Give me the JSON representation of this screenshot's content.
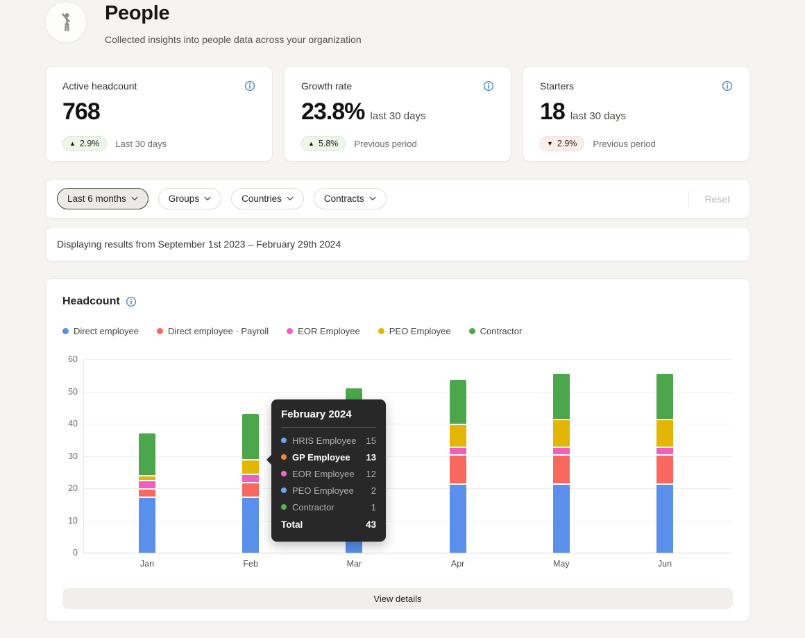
{
  "header": {
    "title": "People",
    "subtitle": "Collected insights into people data across your organization"
  },
  "stats": [
    {
      "label": "Active headcount",
      "value": "768",
      "suffix": "",
      "badge": {
        "dir": "up",
        "arrow": "▲",
        "text": "2.9%"
      },
      "badge_label": "Last 30 days"
    },
    {
      "label": "Growth rate",
      "value": "23.8%",
      "suffix": "last 30 days",
      "badge": {
        "dir": "up",
        "arrow": "▲",
        "text": "5.8%"
      },
      "badge_label": "Previous period"
    },
    {
      "label": "Starters",
      "value": "18",
      "suffix": "last 30 days",
      "badge": {
        "dir": "down",
        "arrow": "▼",
        "text": "2.9%"
      },
      "badge_label": "Previous period"
    }
  ],
  "filters": {
    "pills": [
      {
        "label": "Last 6 months",
        "active": true
      },
      {
        "label": "Groups",
        "active": false
      },
      {
        "label": "Countries",
        "active": false
      },
      {
        "label": "Contracts",
        "active": false
      }
    ],
    "reset_label": "Reset"
  },
  "banner": {
    "text": "Displaying results from September 1st 2023 – February 29th 2024"
  },
  "chart": {
    "title": "Headcount"
  },
  "chart_data": {
    "type": "bar",
    "stacked": true,
    "title": "Headcount",
    "categories": [
      "Jan",
      "Feb",
      "Mar",
      "Apr",
      "May",
      "Jun"
    ],
    "series": [
      {
        "name": "Direct employee",
        "color": "#5b8fec",
        "values": [
          17.5,
          17.5,
          17.5,
          21.5,
          21.5,
          21.5
        ]
      },
      {
        "name": "Direct employee · Payroll",
        "color": "#f9685f",
        "values": [
          2.5,
          4.5,
          4.5,
          9,
          9,
          9
        ]
      },
      {
        "name": "EOR Employee",
        "color": "#ee5fc0",
        "values": [
          2.5,
          2.5,
          3,
          2.5,
          2.5,
          2.5
        ]
      },
      {
        "name": "PEO Employee",
        "color": "#e3b505",
        "values": [
          1.5,
          4.5,
          6,
          7,
          8.5,
          8.5
        ]
      },
      {
        "name": "Contractor",
        "color": "#4ca64c",
        "values": [
          13,
          14,
          20,
          13.5,
          14,
          14
        ]
      }
    ],
    "totals": [
      37,
      43,
      51,
      53.5,
      55.5,
      55.5
    ],
    "ylim": [
      0,
      60
    ],
    "yticks": [
      0,
      10,
      20,
      30,
      40,
      50,
      60
    ],
    "grid": true,
    "legend_position": "top"
  },
  "tooltip": {
    "title": "February 2024",
    "rows": [
      {
        "label": "HRIS Employee",
        "value": "15",
        "color": "#6ca6ea",
        "emphasis": false
      },
      {
        "label": "GP Employee",
        "value": "13",
        "color": "#ef8b3d",
        "emphasis": true
      },
      {
        "label": "EOR Employee",
        "value": "12",
        "color": "#f468c6",
        "emphasis": false
      },
      {
        "label": "PEO Employee",
        "value": "2",
        "color": "#6ca6ea",
        "emphasis": false
      },
      {
        "label": "Contractor",
        "value": "1",
        "color": "#58b158",
        "emphasis": false
      }
    ],
    "total_label": "Total",
    "total_value": "43"
  },
  "view_details_label": "View details"
}
